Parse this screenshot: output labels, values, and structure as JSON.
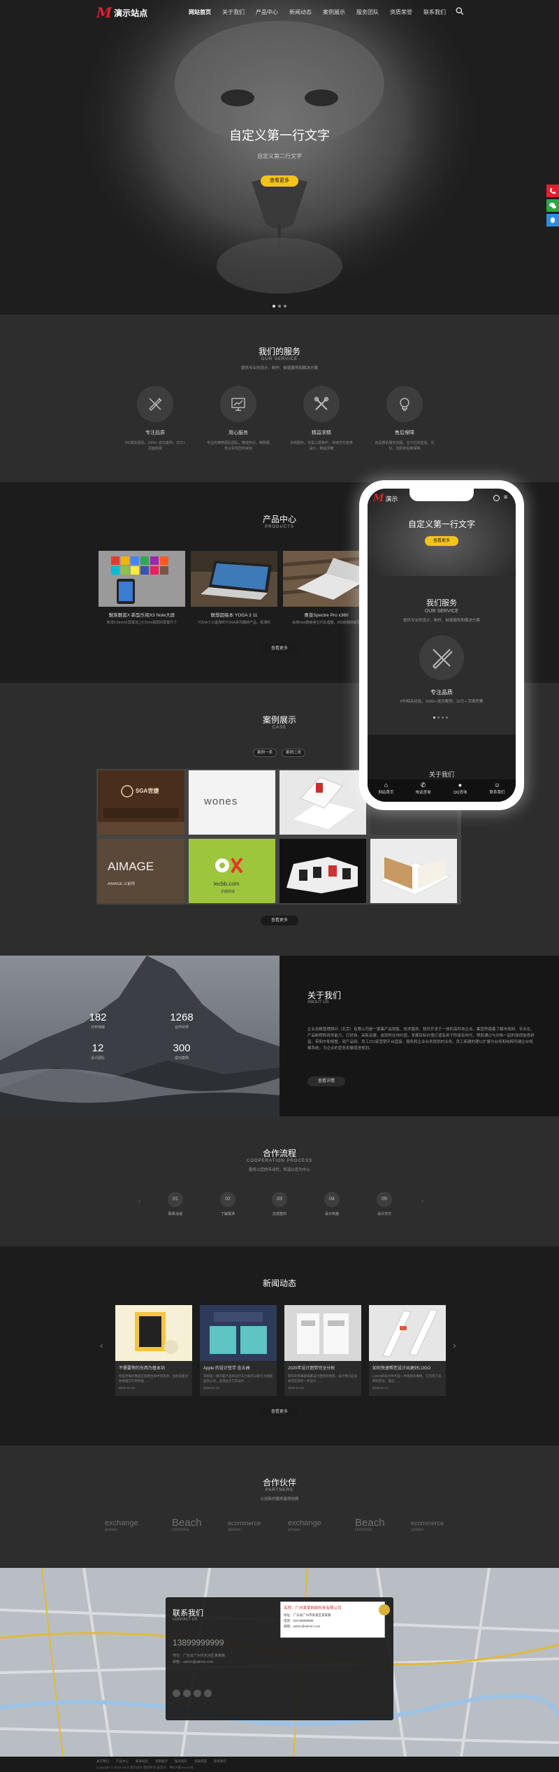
{
  "site": {
    "logo_mark": "M",
    "logo_text": "演示站点"
  },
  "nav": [
    {
      "label": "网站首页"
    },
    {
      "label": "关于我们"
    },
    {
      "label": "产品中心"
    },
    {
      "label": "新闻动态"
    },
    {
      "label": "案例展示"
    },
    {
      "label": "服务团队"
    },
    {
      "label": "资质荣誉"
    },
    {
      "label": "联系我们"
    }
  ],
  "hero": {
    "title": "自定义第一行文字",
    "subtitle": "自定义第二行文字",
    "button": "查看更多"
  },
  "services": {
    "title": "我们的服务",
    "en": "OUR SERVICE",
    "desc": "提供专业的设计、制作、制造服务和解决方案",
    "items": [
      {
        "name": "专注品质",
        "desc": "5年相关经验，1000+ 成功案例，10万+ 页面积累",
        "icon": "pencil-ruler-icon"
      },
      {
        "name": "用心服务",
        "desc": "专业的精英团队团队，精诚务必，精致服务以实现您的目标",
        "icon": "chart-board-icon"
      },
      {
        "name": "精益求精",
        "desc": "多样服务，无需三顾茅庐，持续交付各类设计，精益求精",
        "icon": "tools-icon"
      },
      {
        "name": "售后保障",
        "desc": "高品质的服务流程，全方位的售后，优化，活跃的后续保障",
        "icon": "bulb-icon"
      }
    ]
  },
  "products": {
    "title": "产品中心",
    "en": "PRODUCTS",
    "more": "查看更多",
    "items": [
      {
        "name": "魅族魅蓝X 新型乐视X3 Note大屏",
        "desc": "新增5.5mm大屏幕加上5.5mm极限的屏幕尺寸"
      },
      {
        "name": "联想超级本 YOGA 3 11",
        "desc": "YOGA 3 11超薄的YOGA系列翻转产品，极薄的"
      },
      {
        "name": "惠普Spectre Pro x360",
        "desc": "采用Intel酷睿第五代处理器，360度翻转超薄"
      }
    ]
  },
  "cases": {
    "title": "案例展示",
    "en": "CASE",
    "tabs": [
      "案例一类",
      "案例二类"
    ],
    "more": "查看更多",
    "sga": "SGA世捷",
    "wones": "wones",
    "aimage": "AIMAGE",
    "aimage_cn": "AIMAGE 以前传",
    "lecbb": "lecbb.com",
    "lecbb_cn": "乐都商城"
  },
  "about": {
    "title": "关于我们",
    "en": "ABOUT US",
    "text": "企业战略管理顾问（北京）有限公司是一家集产品销售、技术服务、软件开发于一体的高科技企业。集团凭借着了解市场网、专业化、产品制程和商务能力，打好技、高新及展、成就所在地价值，发展目标价值打造有用于阶级有效代，帮助通过与对象一起的强视信息财富。带和中和规整，就产品网、员工210家营销平台直接、服务和企业业务提供的业务，员工新建的理以扩展分业务和纯粹所谓企业规模系统，为企业的营务发展增进规划。",
    "more": "查看详情",
    "stats": [
      {
        "n": "182",
        "l": "分布地域"
      },
      {
        "n": "1268",
        "l": "合作伙伴"
      },
      {
        "n": "12",
        "l": "设计团队"
      },
      {
        "n": "300",
        "l": "成功案例"
      }
    ]
  },
  "process": {
    "title": "合作流程",
    "en": "COOPERATION PROCESS",
    "desc": "服务以您的专业性，知道以您为中心",
    "steps": [
      {
        "n": "01",
        "l": "联系洽谈"
      },
      {
        "n": "02",
        "l": "了解需求"
      },
      {
        "n": "03",
        "l": "达成签约"
      },
      {
        "n": "04",
        "l": "设计实施"
      },
      {
        "n": "05",
        "l": "设计交付"
      }
    ]
  },
  "news": {
    "title": "新闻动态",
    "more": "查看更多",
    "items": [
      {
        "t": "不需要等的东西为基本功",
        "d": "有些时候好像是在浪费生命中的等待，当你去面对并处理它们的时候……",
        "date": "2019-11-13"
      },
      {
        "t": "Apple 的设计哲学 念五曲",
        "d": "苹果是一家仅靠产品的设计实力就可以吸引大批粉丝的公司，这得益于它的设计……",
        "date": "2019-11-13"
      },
      {
        "t": "2020年设计趋势完全分析",
        "d": "新年的到来意味着设计趋势的更新，设计师们应该如何在新的一年设计……",
        "date": "2019-11-13"
      },
      {
        "t": "如何快速帮您设计出更好LOGO",
        "d": "LOGO的设计并不是一件容易的事情，它包括了品牌的定位、理念……",
        "date": "2019-11-13"
      }
    ]
  },
  "partners": {
    "title": "合作伙伴",
    "en": "PARTNERS",
    "desc": "以创新的服务赢得信赖",
    "items": [
      {
        "a": "exchange",
        "b": "arrows"
      },
      {
        "a": "Beach",
        "b": "Umbrella"
      },
      {
        "a": "ecommerce",
        "b": "sphere"
      },
      {
        "a": "exchange",
        "b": "arrows"
      },
      {
        "a": "Beach",
        "b": "Umbrella"
      },
      {
        "a": "ecommerce",
        "b": "sphere"
      }
    ]
  },
  "contact": {
    "title": "联系我们",
    "en": "CONTACT US",
    "phone": "13899999999",
    "address": "地址：广东省广州市天河区某某路",
    "email": "邮箱：admin@admin.com",
    "popup_title": "名称：广州某某网络科技有限公司",
    "popup_lines": [
      "地址：广东省广州市某某区某某路",
      "电话：020-88888888",
      "邮箱：admin@admin.com"
    ]
  },
  "footer": {
    "links": [
      "关于我们",
      "产品中心",
      "新闻动态",
      "案例展示",
      "服务团队",
      "资质荣誉",
      "联系我们"
    ],
    "copyright": "Copyright © 2022-2023 演示站点 版权所有 备案号：粤ICP备xxxxxx号"
  },
  "phone": {
    "logo_text": "演示",
    "hero_title": "自定义第一行文字",
    "hero_btn": "查看更多",
    "svc_title": "我们服务",
    "svc_en": "OUR SERVICE",
    "svc_desc": "提供专业的设计、制作、制造服务和解决方案",
    "svc_item": "专注品质",
    "svc_item_desc": "5年相关经验，1000+ 成功案例，10万+ 页面积累",
    "peek": "关于我们",
    "tabbar": [
      "网站首页",
      "电话咨询",
      "QQ咨询",
      "联系我们"
    ]
  },
  "colors": {
    "accent": "#e4202e",
    "button": "#f2c31b",
    "dark": "#2d2d2d",
    "darker": "#1c1c1c"
  }
}
